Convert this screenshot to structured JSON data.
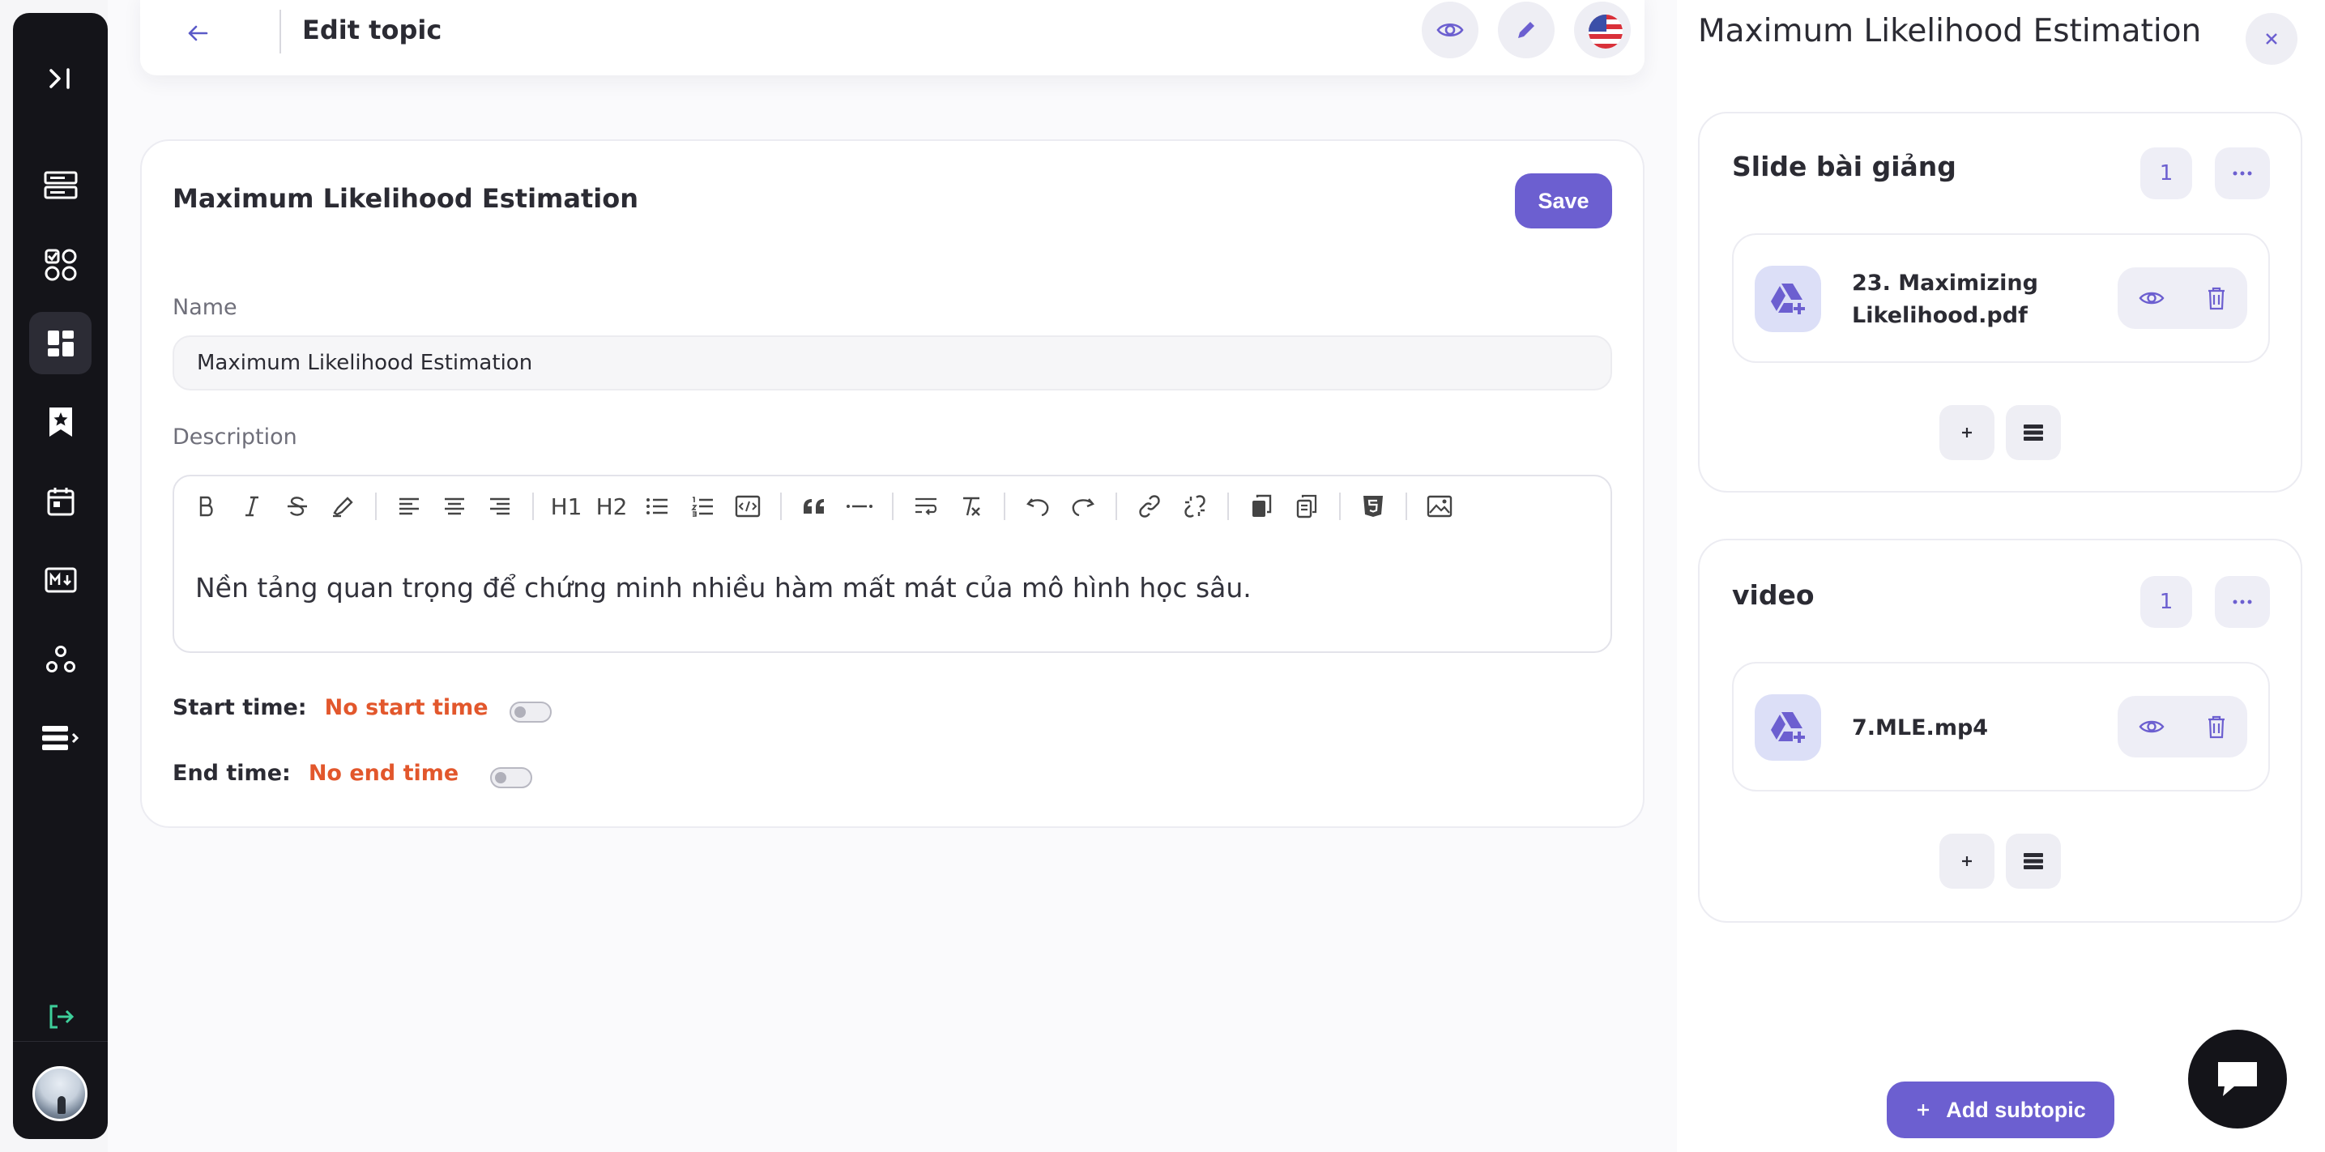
{
  "topbar": {
    "title": "Edit topic"
  },
  "topic": {
    "card_title": "Maximum Likelihood Estimation",
    "save_label": "Save",
    "name_label": "Name",
    "name_value": "Maximum Likelihood Estimation",
    "description_label": "Description",
    "description_text": "Nền tảng quan trọng để chứng minh nhiều hàm mất mát của mô hình học sâu.",
    "start_time_label": "Start time:",
    "start_time_value": "No start time",
    "end_time_label": "End time:",
    "end_time_value": "No end time"
  },
  "editor_toolbar": {
    "h1": "H1",
    "h2": "H2"
  },
  "panel": {
    "title": "Maximum Likelihood Estimation",
    "sections": [
      {
        "title": "Slide bài giảng",
        "count": "1",
        "file_line1": "23. Maximizing",
        "file_line2": "Likelihood.pdf"
      },
      {
        "title": "video",
        "count": "1",
        "file_line1": "7.MLE.mp4"
      }
    ],
    "add_subtopic_label": "Add subtopic"
  },
  "colors": {
    "accent": "#6c5fd0",
    "sidebar": "#141419",
    "warning_text": "#e2572c"
  }
}
